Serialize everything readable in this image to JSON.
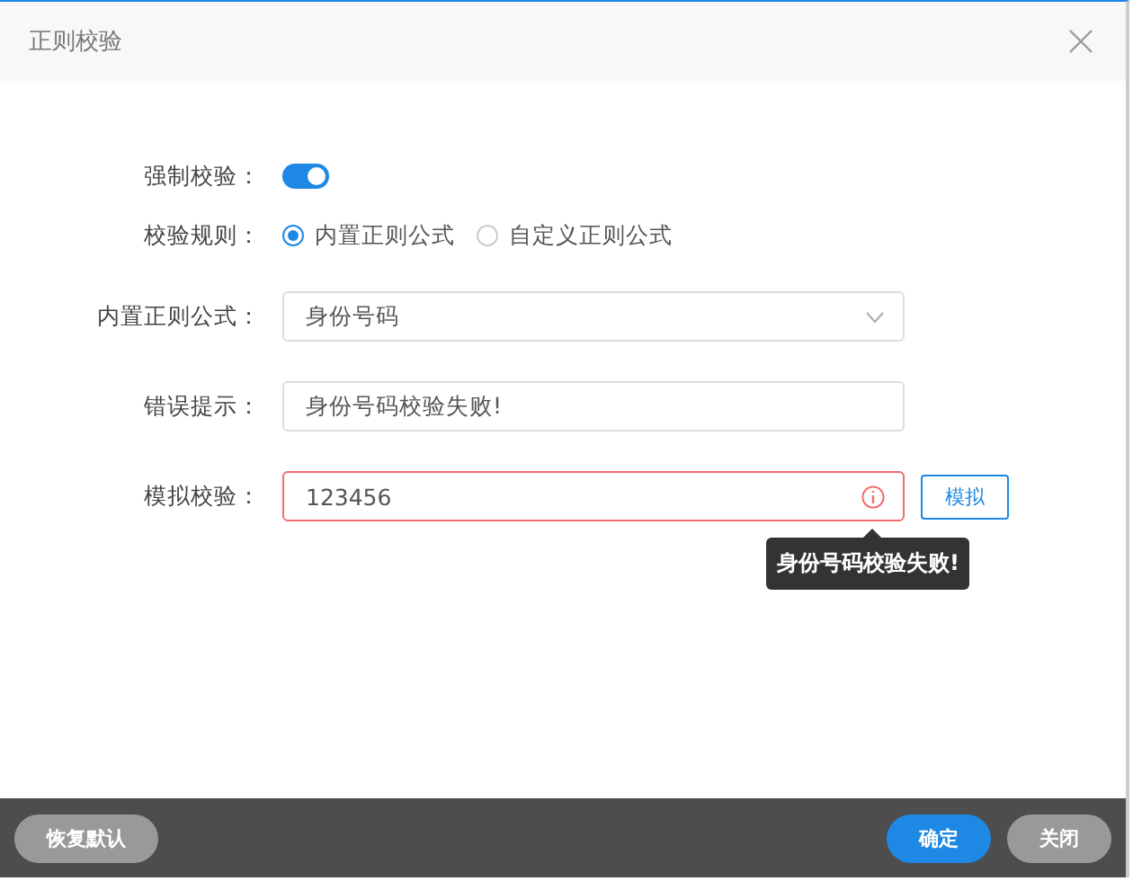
{
  "window": {
    "title": "正则校验"
  },
  "form": {
    "force": {
      "label": "强制校验：",
      "on": true
    },
    "rule": {
      "label": "校验规则：",
      "options": [
        {
          "label": "内置正则公式",
          "selected": true
        },
        {
          "label": "自定义正则公式",
          "selected": false
        }
      ]
    },
    "builtin": {
      "label": "内置正则公式：",
      "value": "身份号码"
    },
    "error_tip": {
      "label": "错误提示：",
      "value": "身份号码校验失败!"
    },
    "simulate": {
      "label": "模拟校验：",
      "value": "123456",
      "invalid": true,
      "button": "模拟",
      "tooltip": "身份号码校验失败!"
    }
  },
  "footer": {
    "reset": "恢复默认",
    "ok": "确定",
    "close": "关闭"
  }
}
